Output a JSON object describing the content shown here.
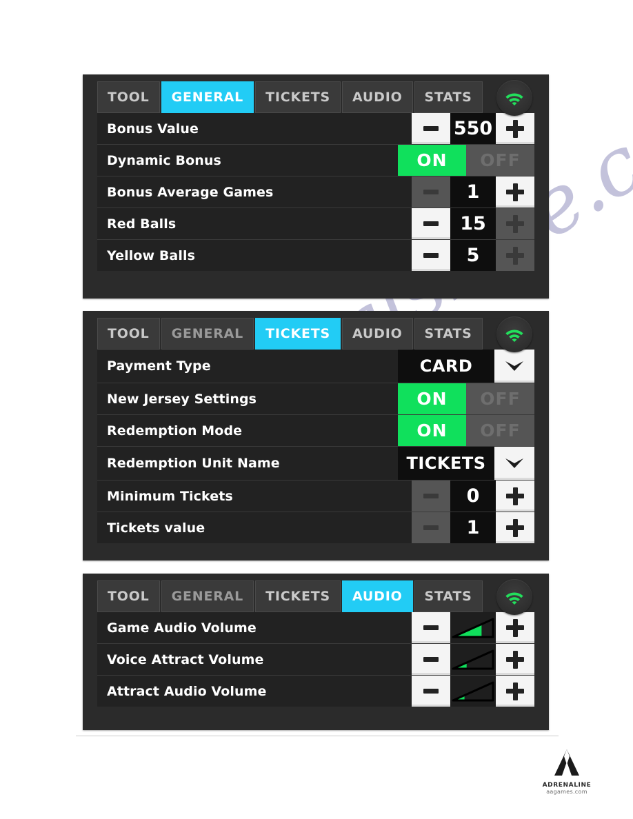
{
  "watermark": {
    "text": "manualshive.com"
  },
  "colors": {
    "accent_cyan": "#22ccf5",
    "toggle_on_green": "#10e05c",
    "toggle_off_grey": "#555555",
    "wifi_green": "#22e05c",
    "panel_bg": "#2b2b2b",
    "row_bg": "#222222",
    "value_bg": "#0e0e0e",
    "button_white": "#f4f4f4",
    "page_bg": "#ffffff"
  },
  "panels": [
    {
      "id": "general",
      "tabs": [
        {
          "label": "TOOL",
          "state": "normal"
        },
        {
          "label": "GENERAL",
          "state": "active"
        },
        {
          "label": "TICKETS",
          "state": "normal"
        },
        {
          "label": "AUDIO",
          "state": "normal"
        },
        {
          "label": "STATS",
          "state": "normal"
        }
      ],
      "status_icon": "wifi-icon",
      "rows": [
        {
          "label": "Bonus Value",
          "control": "stepper",
          "value": "550",
          "minus_enabled": true,
          "plus_enabled": true
        },
        {
          "label": "Dynamic Bonus",
          "control": "toggle",
          "on_label": "ON",
          "off_label": "OFF",
          "selected": "ON"
        },
        {
          "label": "Bonus Average Games",
          "control": "stepper",
          "value": "1",
          "minus_enabled": false,
          "plus_enabled": true
        },
        {
          "label": "Red Balls",
          "control": "stepper",
          "value": "15",
          "minus_enabled": true,
          "plus_enabled": false
        },
        {
          "label": "Yellow Balls",
          "control": "stepper",
          "value": "5",
          "minus_enabled": true,
          "plus_enabled": false
        }
      ]
    },
    {
      "id": "tickets",
      "tabs": [
        {
          "label": "TOOL",
          "state": "normal"
        },
        {
          "label": "GENERAL",
          "state": "dim"
        },
        {
          "label": "TICKETS",
          "state": "active"
        },
        {
          "label": "AUDIO",
          "state": "normal"
        },
        {
          "label": "STATS",
          "state": "normal"
        }
      ],
      "status_icon": "wifi-icon",
      "rows": [
        {
          "label": "Payment Type",
          "control": "dropdown",
          "value": "CARD"
        },
        {
          "label": "New Jersey Settings",
          "control": "toggle",
          "on_label": "ON",
          "off_label": "OFF",
          "selected": "ON"
        },
        {
          "label": "Redemption Mode",
          "control": "toggle",
          "on_label": "ON",
          "off_label": "OFF",
          "selected": "ON"
        },
        {
          "label": "Redemption Unit Name",
          "control": "dropdown",
          "value": "TICKETS"
        },
        {
          "label": "Minimum Tickets",
          "control": "stepper",
          "value": "0",
          "minus_enabled": false,
          "plus_enabled": true
        },
        {
          "label": "Tickets value",
          "control": "stepper",
          "value": "1",
          "minus_enabled": false,
          "plus_enabled": true
        }
      ]
    },
    {
      "id": "audio",
      "tabs": [
        {
          "label": "TOOL",
          "state": "normal"
        },
        {
          "label": "GENERAL",
          "state": "dim"
        },
        {
          "label": "TICKETS",
          "state": "normal"
        },
        {
          "label": "AUDIO",
          "state": "active"
        },
        {
          "label": "STATS",
          "state": "normal"
        }
      ],
      "status_icon": "wifi-icon",
      "rows": [
        {
          "label": "Game Audio Volume",
          "control": "volume",
          "level_percent": 70,
          "minus_enabled": true,
          "plus_enabled": true
        },
        {
          "label": "Voice Attract Volume",
          "control": "volume",
          "level_percent": 35,
          "minus_enabled": true,
          "plus_enabled": true
        },
        {
          "label": "Attract Audio Volume",
          "control": "volume",
          "level_percent": 30,
          "minus_enabled": true,
          "plus_enabled": true
        }
      ]
    }
  ],
  "footer": {
    "logo_name": "ADRENALINE",
    "logo_url": "aagames.com"
  }
}
